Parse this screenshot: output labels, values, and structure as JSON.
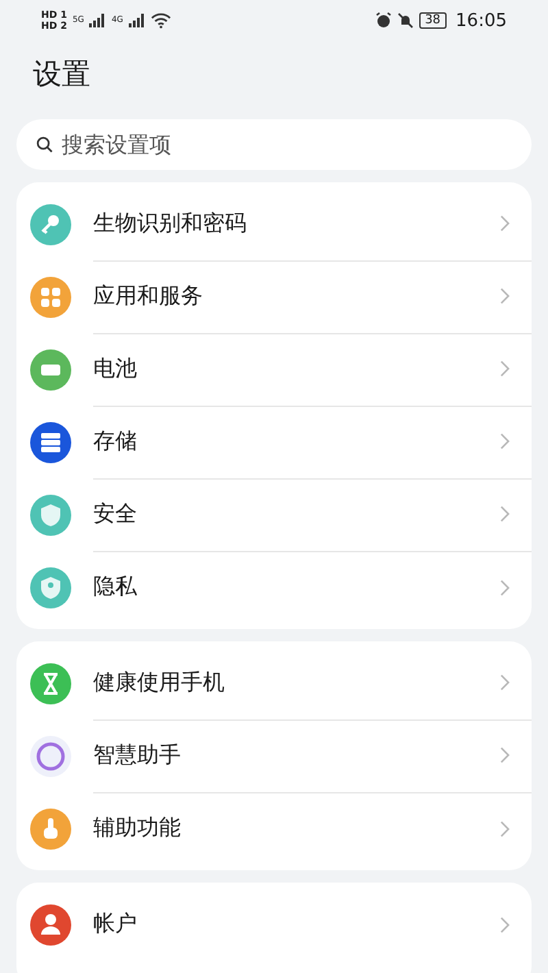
{
  "status_bar": {
    "sims": [
      {
        "label": "HD",
        "slot": "1"
      },
      {
        "label": "HD",
        "slot": "2"
      }
    ],
    "signals": [
      {
        "network": "5G"
      },
      {
        "network": "4G"
      }
    ],
    "battery": "38",
    "time": "16:05"
  },
  "title": "设置",
  "search": {
    "placeholder": "搜索设置项"
  },
  "groups": [
    {
      "items": [
        {
          "label": "生物识别和密码",
          "kind": "key",
          "color": "#4fc3b4"
        },
        {
          "label": "应用和服务",
          "kind": "grid",
          "color": "#f2a33a"
        },
        {
          "label": "电池",
          "kind": "battery",
          "color": "#5cb85c"
        },
        {
          "label": "存储",
          "kind": "storage",
          "color": "#1a56db"
        },
        {
          "label": "安全",
          "kind": "shield",
          "color": "#4fc3b4"
        },
        {
          "label": "隐私",
          "kind": "privacy",
          "color": "#4fc3b4"
        }
      ]
    },
    {
      "items": [
        {
          "label": "健康使用手机",
          "kind": "hourglass",
          "color": "#3cbf55"
        },
        {
          "label": "智慧助手",
          "kind": "ring",
          "color": "#a070e0"
        },
        {
          "label": "辅助功能",
          "kind": "hand",
          "color": "#f2a33a"
        }
      ]
    },
    {
      "items": [
        {
          "label": "帐户",
          "kind": "person",
          "color": "#e0472f"
        }
      ]
    }
  ]
}
